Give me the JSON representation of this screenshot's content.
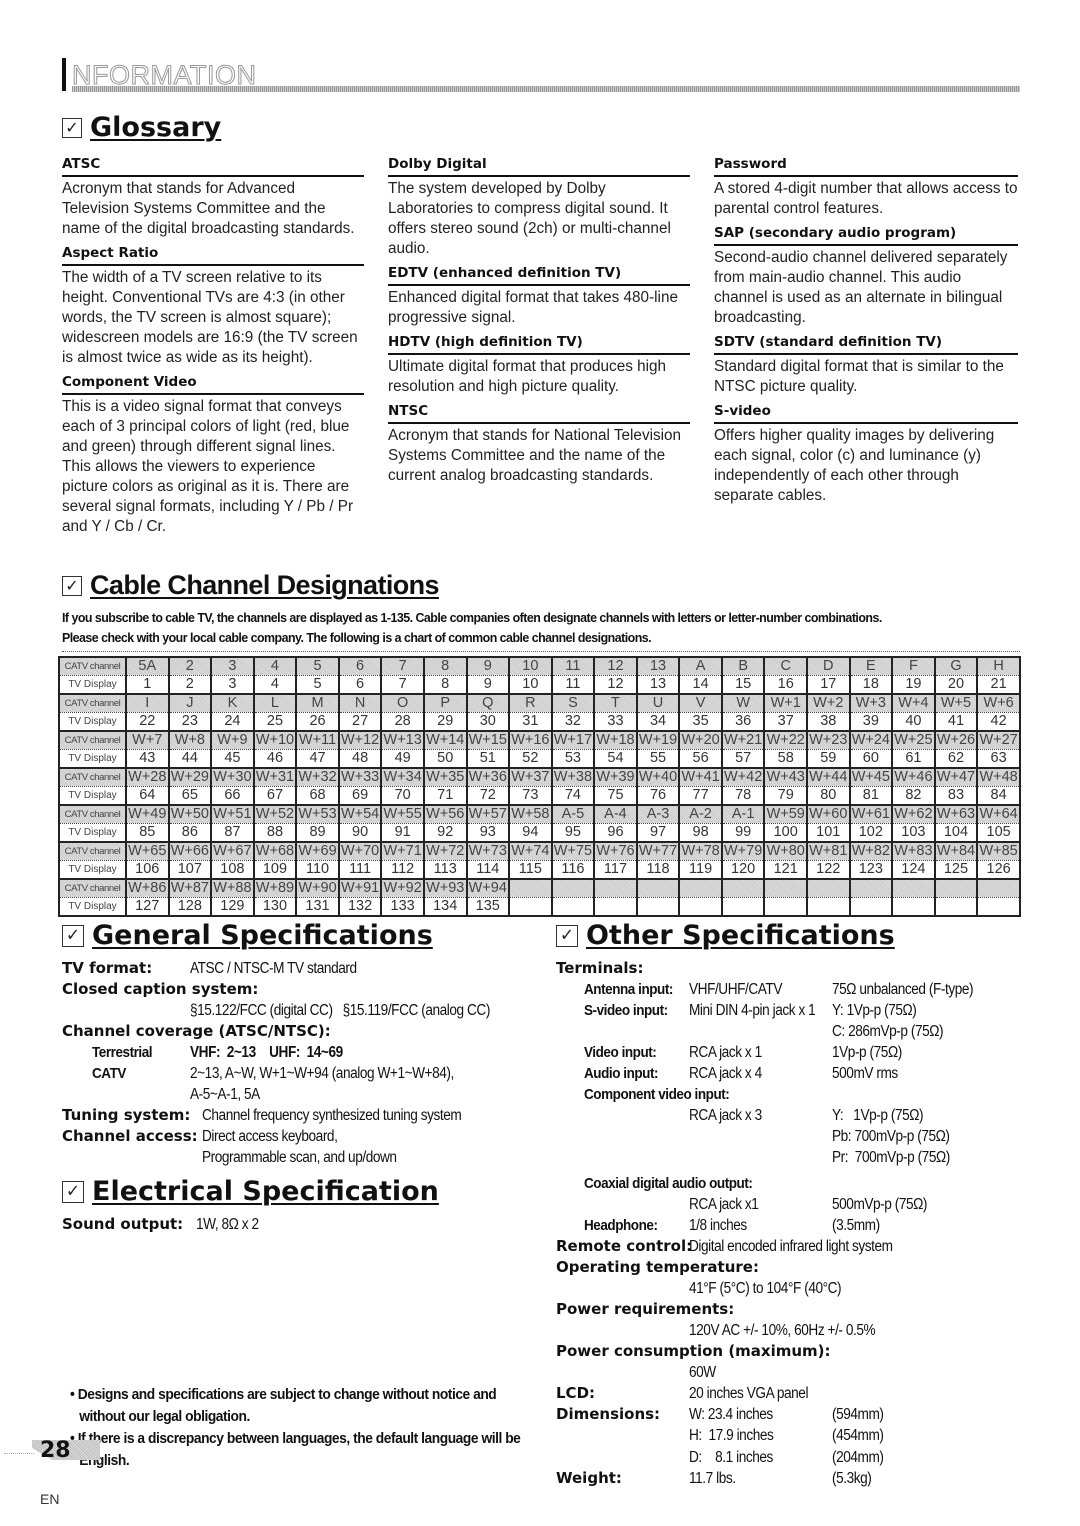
{
  "header": {
    "title": "NFORMATION"
  },
  "glossary": {
    "title": "Glossary",
    "columns": [
      [
        {
          "term": "ATSC",
          "definition": "Acronym that stands for Advanced Television Systems Committee and the name of the digital broadcasting standards."
        },
        {
          "term": "Aspect Ratio",
          "definition": "The width of a TV screen relative to its height. Conventional TVs are 4:3 (in other words, the TV screen is almost square); widescreen models are 16:9 (the TV screen is almost twice as wide as its height)."
        },
        {
          "term": "Component Video",
          "definition": "This is a video signal format that conveys each of 3 principal colors of light (red, blue and green) through different signal lines. This allows the viewers to experience picture colors as original as it is. There are several signal formats, including Y / Pb / Pr and Y / Cb / Cr."
        }
      ],
      [
        {
          "term": "Dolby Digital",
          "definition": "The system developed by Dolby Laboratories to compress digital sound. It offers stereo sound (2ch) or multi-channel audio."
        },
        {
          "term": "EDTV (enhanced definition TV)",
          "definition": "Enhanced digital format that takes 480-line progressive signal."
        },
        {
          "term": "HDTV (high definition TV)",
          "definition": "Ultimate digital format that produces high resolution and high picture quality."
        },
        {
          "term": "NTSC",
          "definition": "Acronym that stands for National Television Systems Committee and the name of the current analog broadcasting standards."
        }
      ],
      [
        {
          "term": "Password",
          "definition": "A stored 4-digit number that allows access to parental control features."
        },
        {
          "term": "SAP (secondary audio program)",
          "definition": "Second-audio channel delivered separately from main-audio channel. This audio channel is used as an alternate in bilingual broadcasting."
        },
        {
          "term": "SDTV (standard definition TV)",
          "definition": "Standard digital format that is similar to the NTSC picture quality."
        },
        {
          "term": "S-video",
          "definition": "Offers higher quality images by delivering each signal, color (c) and luminance (y) independently of each other through separate cables."
        }
      ]
    ]
  },
  "cable": {
    "title": "Cable Channel Designations",
    "intro_line1": "If you subscribe to cable TV, the channels are displayed as 1-135. Cable companies often designate channels with letters or letter-number combinations.",
    "intro_line2": "Please check with your local cable company. The following is a chart of common cable channel designations.",
    "catv_label": "CATV channel",
    "display_label": "TV Display",
    "rows": [
      {
        "catv": [
          "5A",
          "2",
          "3",
          "4",
          "5",
          "6",
          "7",
          "8",
          "9",
          "10",
          "11",
          "12",
          "13",
          "A",
          "B",
          "C",
          "D",
          "E",
          "F",
          "G",
          "H"
        ],
        "display": [
          "1",
          "2",
          "3",
          "4",
          "5",
          "6",
          "7",
          "8",
          "9",
          "10",
          "11",
          "12",
          "13",
          "14",
          "15",
          "16",
          "17",
          "18",
          "19",
          "20",
          "21"
        ]
      },
      {
        "catv": [
          "I",
          "J",
          "K",
          "L",
          "M",
          "N",
          "O",
          "P",
          "Q",
          "R",
          "S",
          "T",
          "U",
          "V",
          "W",
          "W+1",
          "W+2",
          "W+3",
          "W+4",
          "W+5",
          "W+6"
        ],
        "display": [
          "22",
          "23",
          "24",
          "25",
          "26",
          "27",
          "28",
          "29",
          "30",
          "31",
          "32",
          "33",
          "34",
          "35",
          "36",
          "37",
          "38",
          "39",
          "40",
          "41",
          "42"
        ]
      },
      {
        "catv": [
          "W+7",
          "W+8",
          "W+9",
          "W+10",
          "W+11",
          "W+12",
          "W+13",
          "W+14",
          "W+15",
          "W+16",
          "W+17",
          "W+18",
          "W+19",
          "W+20",
          "W+21",
          "W+22",
          "W+23",
          "W+24",
          "W+25",
          "W+26",
          "W+27"
        ],
        "display": [
          "43",
          "44",
          "45",
          "46",
          "47",
          "48",
          "49",
          "50",
          "51",
          "52",
          "53",
          "54",
          "55",
          "56",
          "57",
          "58",
          "59",
          "60",
          "61",
          "62",
          "63"
        ]
      },
      {
        "catv": [
          "W+28",
          "W+29",
          "W+30",
          "W+31",
          "W+32",
          "W+33",
          "W+34",
          "W+35",
          "W+36",
          "W+37",
          "W+38",
          "W+39",
          "W+40",
          "W+41",
          "W+42",
          "W+43",
          "W+44",
          "W+45",
          "W+46",
          "W+47",
          "W+48"
        ],
        "display": [
          "64",
          "65",
          "66",
          "67",
          "68",
          "69",
          "70",
          "71",
          "72",
          "73",
          "74",
          "75",
          "76",
          "77",
          "78",
          "79",
          "80",
          "81",
          "82",
          "83",
          "84"
        ]
      },
      {
        "catv": [
          "W+49",
          "W+50",
          "W+51",
          "W+52",
          "W+53",
          "W+54",
          "W+55",
          "W+56",
          "W+57",
          "W+58",
          "A-5",
          "A-4",
          "A-3",
          "A-2",
          "A-1",
          "W+59",
          "W+60",
          "W+61",
          "W+62",
          "W+63",
          "W+64"
        ],
        "display": [
          "85",
          "86",
          "87",
          "88",
          "89",
          "90",
          "91",
          "92",
          "93",
          "94",
          "95",
          "96",
          "97",
          "98",
          "99",
          "100",
          "101",
          "102",
          "103",
          "104",
          "105"
        ]
      },
      {
        "catv": [
          "W+65",
          "W+66",
          "W+67",
          "W+68",
          "W+69",
          "W+70",
          "W+71",
          "W+72",
          "W+73",
          "W+74",
          "W+75",
          "W+76",
          "W+77",
          "W+78",
          "W+79",
          "W+80",
          "W+81",
          "W+82",
          "W+83",
          "W+84",
          "W+85"
        ],
        "display": [
          "106",
          "107",
          "108",
          "109",
          "110",
          "111",
          "112",
          "113",
          "114",
          "115",
          "116",
          "117",
          "118",
          "119",
          "120",
          "121",
          "122",
          "123",
          "124",
          "125",
          "126"
        ]
      },
      {
        "catv": [
          "W+86",
          "W+87",
          "W+88",
          "W+89",
          "W+90",
          "W+91",
          "W+92",
          "W+93",
          "W+94",
          "",
          "",
          "",
          "",
          "",
          "",
          "",
          "",
          "",
          "",
          "",
          ""
        ],
        "display": [
          "127",
          "128",
          "129",
          "130",
          "131",
          "132",
          "133",
          "134",
          "135",
          "",
          "",
          "",
          "",
          "",
          "",
          "",
          "",
          "",
          "",
          "",
          ""
        ]
      }
    ]
  },
  "general": {
    "title": "General Specifications",
    "tv_format_label": "TV format:",
    "tv_format_value": "ATSC / NTSC-M TV standard",
    "cc_label": "Closed caption system:",
    "cc_value": "§15.122/FCC (digital CC)   §15.119/FCC (analog CC)",
    "coverage_label": "Channel coverage (ATSC/NTSC):",
    "terrestrial_label": "Terrestrial",
    "terrestrial_value": "VHF:  2~13    UHF:  14~69",
    "catv_label": "CATV",
    "catv_value_1": "2~13, A~W, W+1~W+94 (analog W+1~W+84),",
    "catv_value_2": "A-5~A-1, 5A",
    "tuning_label": "Tuning system:",
    "tuning_value": "Channel frequency synthesized tuning system",
    "access_label": "Channel access:",
    "access_value_1": "Direct access keyboard,",
    "access_value_2": "Programmable scan, and up/down"
  },
  "electrical": {
    "title": "Electrical Specification",
    "sound_label": "Sound output:",
    "sound_value": "1W, 8Ω x 2"
  },
  "notes": [
    "• Designs and specifications are subject to change without notice and without our legal obligation.",
    "• If there is a discrepancy between languages, the default language will be English."
  ],
  "other": {
    "title": "Other Specifications",
    "terminals_label": "Terminals:",
    "antenna_label": "Antenna input:",
    "antenna_value": "VHF/UHF/CATV",
    "antenna_spec": "75Ω unbalanced (F-type)",
    "svideo_label": "S-video input:",
    "svideo_value": "Mini DIN 4-pin jack x 1",
    "svideo_spec_1": "Y: 1Vp-p (75Ω)",
    "svideo_spec_2": "C: 286mVp-p (75Ω)",
    "video_label": "Video input:",
    "video_value": "RCA jack x 1",
    "video_spec": "1Vp-p (75Ω)",
    "audio_label": "Audio input:",
    "audio_value": "RCA jack x 4",
    "audio_spec": "500mV rms",
    "component_label": "Component video input:",
    "component_value": "RCA jack x 3",
    "component_spec_1": "Y:   1Vp-p (75Ω)",
    "component_spec_2": "Pb: 700mVp-p (75Ω)",
    "component_spec_3": "Pr:  700mVp-p (75Ω)",
    "coax_label": "Coaxial digital audio output:",
    "coax_value": "RCA jack x1",
    "coax_spec": "500mVp-p (75Ω)",
    "headphone_label": "Headphone:",
    "headphone_value": "1/8 inches",
    "headphone_spec": "(3.5mm)",
    "remote_label": "Remote control:",
    "remote_value": "Digital encoded infrared light system",
    "temp_label": "Operating temperature:",
    "temp_value": "41°F (5°C) to 104°F (40°C)",
    "power_req_label": "Power requirements:",
    "power_req_value": "120V AC +/- 10%, 60Hz +/- 0.5%",
    "power_cons_label": "Power consumption (maximum):",
    "power_cons_value": "60W",
    "lcd_label": "LCD:",
    "lcd_value": "20 inches VGA panel",
    "dim_label": "Dimensions:",
    "dim_w": "W: 23.4 inches",
    "dim_w_mm": "(594mm)",
    "dim_h": "H:  17.9 inches",
    "dim_h_mm": "(454mm)",
    "dim_d": "D:    8.1 inches",
    "dim_d_mm": "(204mm)",
    "weight_label": "Weight:",
    "weight_value": "11.7 lbs.",
    "weight_kg": "(5.3kg)"
  },
  "footer": {
    "page_number": "28",
    "language": "EN"
  }
}
